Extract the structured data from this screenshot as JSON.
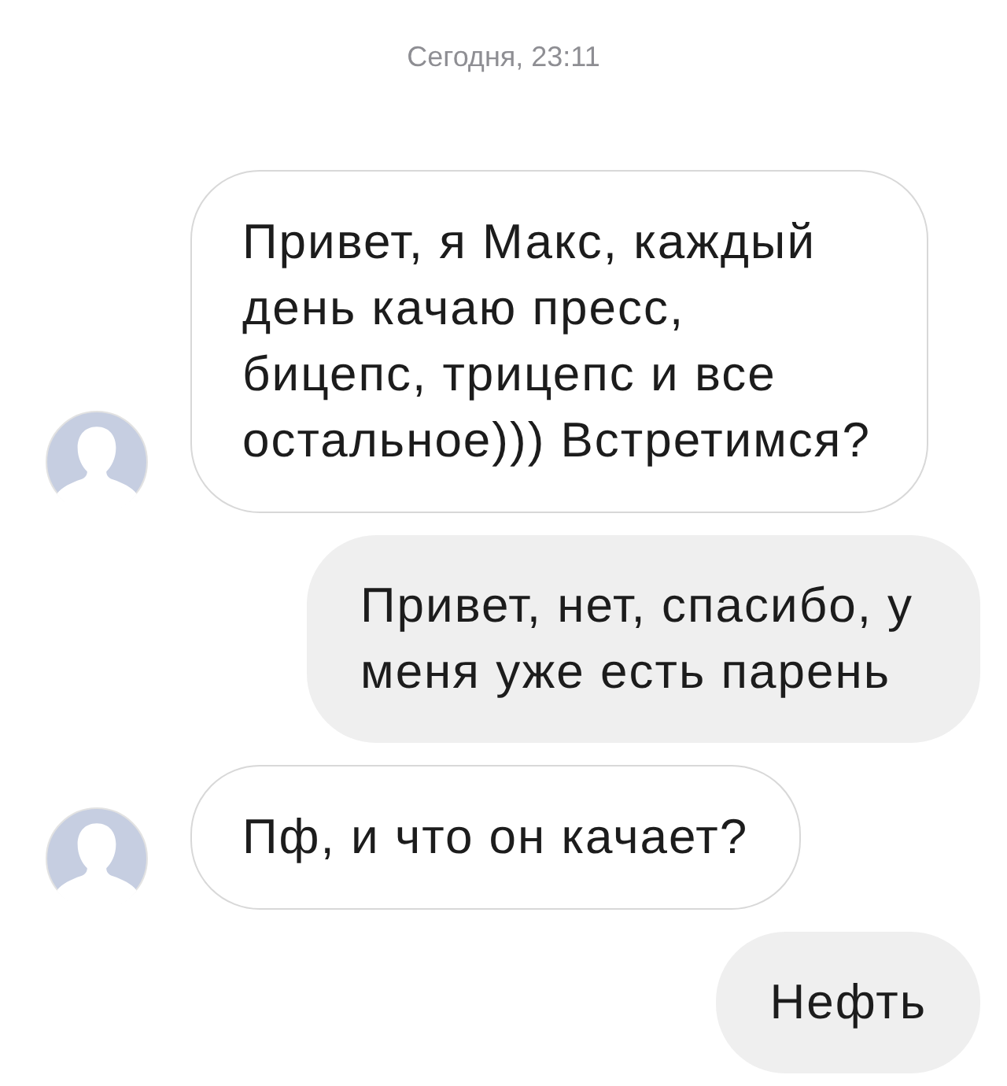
{
  "timestamp": "Сегодня, 23:11",
  "messages": [
    {
      "kind": "incoming",
      "text": "Привет, я Макс, каждый день качаю пресс, бицепс, трицепс и все остальное))) Встретимся?"
    },
    {
      "kind": "outgoing",
      "text": "Привет, нет, спасибо, у меня уже есть парень"
    },
    {
      "kind": "incoming",
      "text": "Пф, и что он качает?"
    },
    {
      "kind": "outgoing",
      "text": "Нефть"
    }
  ]
}
